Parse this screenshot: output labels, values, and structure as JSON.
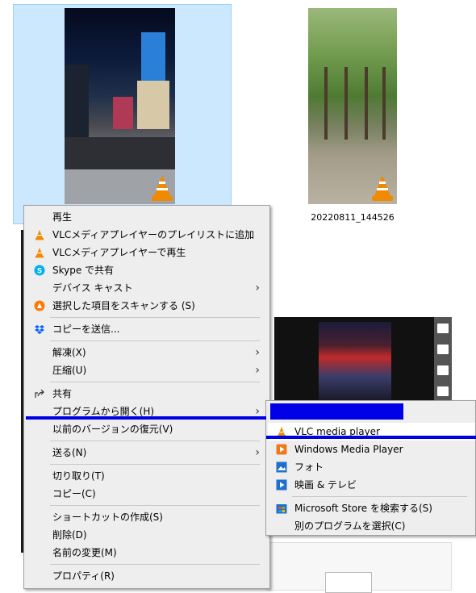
{
  "files": [
    {
      "name": ""
    },
    {
      "name": "20220811_144526"
    }
  ],
  "context_menu": {
    "items": [
      {
        "label": "再生",
        "icon": ""
      },
      {
        "label": "VLCメディアプレイヤーのプレイリストに追加",
        "icon": "vlc-cone-icon"
      },
      {
        "label": "VLCメディアプレイヤーで再生",
        "icon": "vlc-cone-icon"
      },
      {
        "label": "Skype で共有",
        "icon": "skype-icon"
      },
      {
        "label": "デバイス キャスト",
        "icon": "",
        "submenu": true
      },
      {
        "label": "選択した項目をスキャンする (S)",
        "icon": "avast-icon"
      },
      {
        "label": "コピーを送信...",
        "icon": "dropbox-icon"
      },
      {
        "label": "解凍(X)",
        "icon": "",
        "submenu": true
      },
      {
        "label": "圧縮(U)",
        "icon": "",
        "submenu": true
      },
      {
        "label": "共有",
        "icon": "share-icon"
      },
      {
        "label": "プログラムから開く(H)",
        "icon": "",
        "submenu": true
      },
      {
        "label": "以前のバージョンの復元(V)",
        "icon": ""
      },
      {
        "label": "送る(N)",
        "icon": "",
        "submenu": true
      },
      {
        "label": "切り取り(T)",
        "icon": ""
      },
      {
        "label": "コピー(C)",
        "icon": ""
      },
      {
        "label": "ショートカットの作成(S)",
        "icon": ""
      },
      {
        "label": "削除(D)",
        "icon": ""
      },
      {
        "label": "名前の変更(M)",
        "icon": ""
      },
      {
        "label": "プロパティ(R)",
        "icon": ""
      }
    ],
    "submenu_arrow": "›"
  },
  "open_with_submenu": {
    "items": [
      {
        "label": "VLC media player",
        "icon": "vlc-cone-icon"
      },
      {
        "label": "Windows Media Player",
        "icon": "windows-media-player-icon"
      },
      {
        "label": "フォト",
        "icon": "photos-icon"
      },
      {
        "label": "映画 & テレビ",
        "icon": "movies-tv-icon"
      },
      {
        "label": "Microsoft Store を検索する(S)",
        "icon": "microsoft-store-icon"
      },
      {
        "label": "別のプログラムを選択(C)",
        "icon": ""
      }
    ]
  },
  "colors": {
    "selection_bg": "#cce8ff",
    "highlight_marker": "#0000e6",
    "menu_bg": "#eeeeee",
    "vlc_orange": "#f08a00"
  }
}
